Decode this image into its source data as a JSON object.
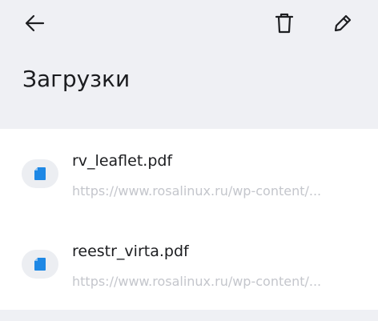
{
  "header": {
    "title": "Загрузки",
    "back_icon": "arrow-left-icon",
    "delete_icon": "trash-icon",
    "edit_icon": "pencil-icon"
  },
  "downloads": [
    {
      "name": "rv_leaflet.pdf",
      "url": "https://www.rosalinux.ru/wp-content/...",
      "icon": "document-icon"
    },
    {
      "name": "reestr_virta.pdf",
      "url": "https://www.rosalinux.ru/wp-content/...",
      "icon": "document-icon"
    }
  ],
  "colors": {
    "background": "#eff0f4",
    "list_background": "#ffffff",
    "file_icon_accent": "#1e88e5",
    "title_text": "#1b1c1f",
    "url_text": "#c4c6cc"
  }
}
